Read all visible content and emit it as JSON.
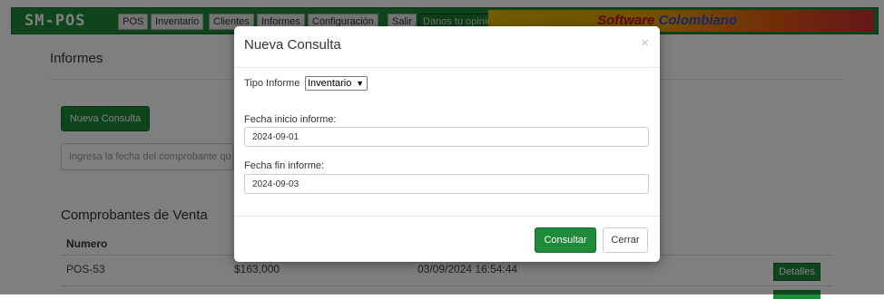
{
  "navbar": {
    "brand": "SM-POS",
    "items": [
      "POS",
      "Inventario",
      "Clientes",
      "Informes",
      "Configuración",
      "Salir"
    ],
    "feedback": "Danos tu opinion",
    "promo_main": "Software",
    "promo_accent": "Colombiano"
  },
  "page": {
    "heading": "Informes",
    "new_query_button": "Nueva Consulta",
    "search_placeholder": "Ingresa la fecha del comprobante qu",
    "section_title": "Comprobantes de Venta",
    "table": {
      "header_numero": "Numero",
      "rows": [
        {
          "numero": "POS-53",
          "total": "$163,000",
          "fecha": "03/09/2024 16:54:44",
          "action": "Detalles"
        }
      ]
    }
  },
  "modal": {
    "title": "Nueva Consulta",
    "close": "×",
    "tipo_label": "Tipo Informe",
    "tipo_value": "Inventario",
    "inicio_label": "Fecha inicio informe:",
    "inicio_value": "2024-09-01",
    "fin_label": "Fecha fin informe:",
    "fin_value": "2024-09-03",
    "consultar": "Consultar",
    "cerrar": "Cerrar"
  },
  "colors": {
    "brand_green": "#1e8a3a",
    "backdrop": "#000000"
  }
}
